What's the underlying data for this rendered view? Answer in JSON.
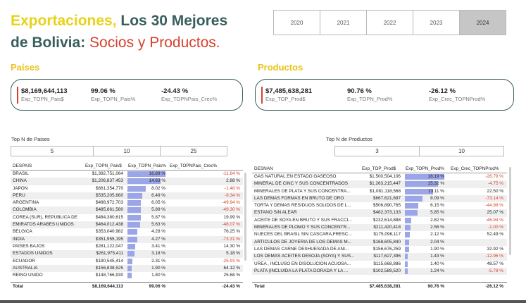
{
  "title": {
    "part1": "Exportaciones,",
    "part2": " Los 30 Mejores",
    "part3": "de Bolivia:",
    "part4": " Socios y Productos."
  },
  "years": [
    {
      "label": "2020",
      "selected": false
    },
    {
      "label": "2021",
      "selected": false
    },
    {
      "label": "2022",
      "selected": false
    },
    {
      "label": "2023",
      "selected": false
    },
    {
      "label": "2024",
      "selected": true
    }
  ],
  "paises": {
    "heading": "Países",
    "kpi": [
      {
        "value": "$8,169,644,113",
        "label": "Exp_TOPN_Pais$"
      },
      {
        "value": "99.06 %",
        "label": "Exp_TOPN_Pais%"
      },
      {
        "value": "-24.43 %",
        "label": "Exp_TOPNPais_Crec%"
      }
    ],
    "topn_title": "Top N de Paises",
    "topn": [
      "5",
      "10",
      "25"
    ],
    "table": {
      "headers": [
        "DESPAIS",
        "Exp_TOPN_Pais$",
        "Exp_TOPN_Pais%",
        "Exp_TOPNPais_Crec%"
      ],
      "rows": [
        {
          "name": "BRASIL",
          "val": "$1,392,751,064",
          "pct": "16.89 %",
          "share": 16.89,
          "crec": "-11.64 %",
          "neg": true
        },
        {
          "name": "CHINA",
          "val": "$1,206,837,453",
          "pct": "14.63 %",
          "share": 14.63,
          "crec": "2.88 %",
          "neg": false
        },
        {
          "name": "JAPON",
          "val": "$661,354,770",
          "pct": "8.02 %",
          "share": 8.02,
          "crec": "-1.48 %",
          "neg": true
        },
        {
          "name": "PERU",
          "val": "$535,205,660",
          "pct": "6.49 %",
          "share": 6.49,
          "crec": "-9.34 %",
          "neg": true
        },
        {
          "name": "ARGENTINA",
          "val": "$498,972,703",
          "pct": "6.05 %",
          "share": 6.05,
          "crec": "-49.94 %",
          "neg": true
        },
        {
          "name": "COLOMBIA",
          "val": "$485,661,580",
          "pct": "5.89 %",
          "share": 5.89,
          "crec": "-49.30 %",
          "neg": true
        },
        {
          "name": "COREA (SUR), REPUBLICA DE",
          "val": "$484,380,615",
          "pct": "5.87 %",
          "share": 5.87,
          "crec": "19.99 %",
          "neg": false
        },
        {
          "name": "EMIRATOS ARABES UNIDOS",
          "val": "$464,012,438",
          "pct": "5.63 %",
          "share": 5.63,
          "crec": "-48.07 %",
          "neg": true
        },
        {
          "name": "BELGICA",
          "val": "$353,040,982",
          "pct": "4.28 %",
          "share": 4.28,
          "crec": "76.25 %",
          "neg": false
        },
        {
          "name": "INDIA",
          "val": "$351,955,195",
          "pct": "4.27 %",
          "share": 4.27,
          "crec": "-73.31 %",
          "neg": true
        },
        {
          "name": "PAISES BAJOS",
          "val": "$281,122,047",
          "pct": "3.41 %",
          "share": 3.41,
          "crec": "14.30 %",
          "neg": false
        },
        {
          "name": "ESTADOS UNIDOS",
          "val": "$261,975,411",
          "pct": "3.18 %",
          "share": 3.18,
          "crec": "5.18 %",
          "neg": false
        },
        {
          "name": "ECUADOR",
          "val": "$190,545,414",
          "pct": "2.31 %",
          "share": 2.31,
          "crec": "-25.93 %",
          "neg": true
        },
        {
          "name": "AUSTRALIA",
          "val": "$156,838,525",
          "pct": "1.90 %",
          "share": 1.9,
          "crec": "64.12 %",
          "neg": false
        },
        {
          "name": "REINO UNIDO",
          "val": "$148,766,930",
          "pct": "1.80 %",
          "share": 1.8,
          "crec": "25.68 %",
          "neg": false
        }
      ],
      "total": {
        "label": "Total",
        "val": "$8,169,644,113",
        "pct": "99.06 %",
        "crec": "-24.43 %"
      }
    }
  },
  "productos": {
    "heading": "Productos",
    "kpi": [
      {
        "value": "$7,485,638,281",
        "label": "Exp_TOP_Prod$"
      },
      {
        "value": "90.76 %",
        "label": "Exp_TOPN_Prod%"
      },
      {
        "value": "-26.12 %",
        "label": "Exp_Crec_TOPNProd%"
      }
    ],
    "topn_title": "Top N de Productos",
    "topn": [
      "3",
      "10"
    ],
    "table": {
      "headers": [
        "DESNAN",
        "Exp_TOP_Prod$",
        "Exp_TOPN_Prod%",
        "Exp_Crec_TOPNProd%"
      ],
      "rows": [
        {
          "name": "GAS NATURAL EN ESTADO GASEOSO",
          "val": "$1,500,504,106",
          "pct": "18.19 %",
          "share": 18.19,
          "crec": "-26.79 %",
          "neg": true
        },
        {
          "name": "MINERAL DE CINC Y SUS CONCENTRADOS",
          "val": "$1,263,215,447",
          "pct": "15.32 %",
          "share": 15.32,
          "crec": "-4.75 %",
          "neg": true
        },
        {
          "name": "MINERALES DE PLATA Y SUS CONCENTRA...",
          "val": "$1,081,118,568",
          "pct": "13.11 %",
          "share": 13.11,
          "crec": "22.50 %",
          "neg": false
        },
        {
          "name": "LAS DEMAS FORMAS EN BRUTO DE ORO",
          "val": "$667,621,697",
          "pct": "8.09 %",
          "share": 8.09,
          "crec": "-73.14 %",
          "neg": true
        },
        {
          "name": "TORTA Y DEMAS RESIDUOS SOLIDOS DE L...",
          "val": "$506,890,765",
          "pct": "6.15 %",
          "share": 6.15,
          "crec": "-44.98 %",
          "neg": true
        },
        {
          "name": "ESTAÑO SIN ALEAR",
          "val": "$482,373,133",
          "pct": "5.85 %",
          "share": 5.85,
          "crec": "25.07 %",
          "neg": false
        },
        {
          "name": "ACEITE DE SOYA EN BRUTO Y SUS FRACCI...",
          "val": "$232,614,888",
          "pct": "2.82 %",
          "share": 2.82,
          "crec": "-46.94 %",
          "neg": true
        },
        {
          "name": "MINERALES DE PLOMO Y SUS CONCENTR...",
          "val": "$211,420,418",
          "pct": "2.56 %",
          "share": 2.56,
          "crec": "-1.00 %",
          "neg": true
        },
        {
          "name": "NUECES DEL BRASIL SIN CASCARA,FRESC...",
          "val": "$175,096,117",
          "pct": "2.12 %",
          "share": 2.12,
          "crec": "52.49 %",
          "neg": false
        },
        {
          "name": "ARTICULOS DE JOYERIA DE LOS DEMAS M...",
          "val": "$168,605,840",
          "pct": "2.04 %",
          "share": 2.04,
          "crec": "",
          "neg": false
        },
        {
          "name": "LAS DEMAS CARNE DESHUESADA DE ANI...",
          "val": "$156,676,259",
          "pct": "1.90 %",
          "share": 1.9,
          "crec": "32.92 %",
          "neg": false
        },
        {
          "name": "LOS DEMAS ACEITES DESOJA (SOYA) Y SUS...",
          "val": "$117,627,396",
          "pct": "1.43 %",
          "share": 1.43,
          "crec": "-12.96 %",
          "neg": true
        },
        {
          "name": "UREA , INCLUSO EN DISOLUCION ACUOSA...",
          "val": "$115,668,886",
          "pct": "1.40 %",
          "share": 1.4,
          "crec": "48.57 %",
          "neg": false
        },
        {
          "name": "PLATA (INCLUIDA LA PLATA DORADA Y LA ...",
          "val": "$102,589,520",
          "pct": "1.24 %",
          "share": 1.24,
          "crec": "-5.78 %",
          "neg": true
        }
      ],
      "total": {
        "label": "Total",
        "val": "$7,485,638,281",
        "pct": "90.76 %",
        "crec": "-26.12 %"
      }
    }
  }
}
